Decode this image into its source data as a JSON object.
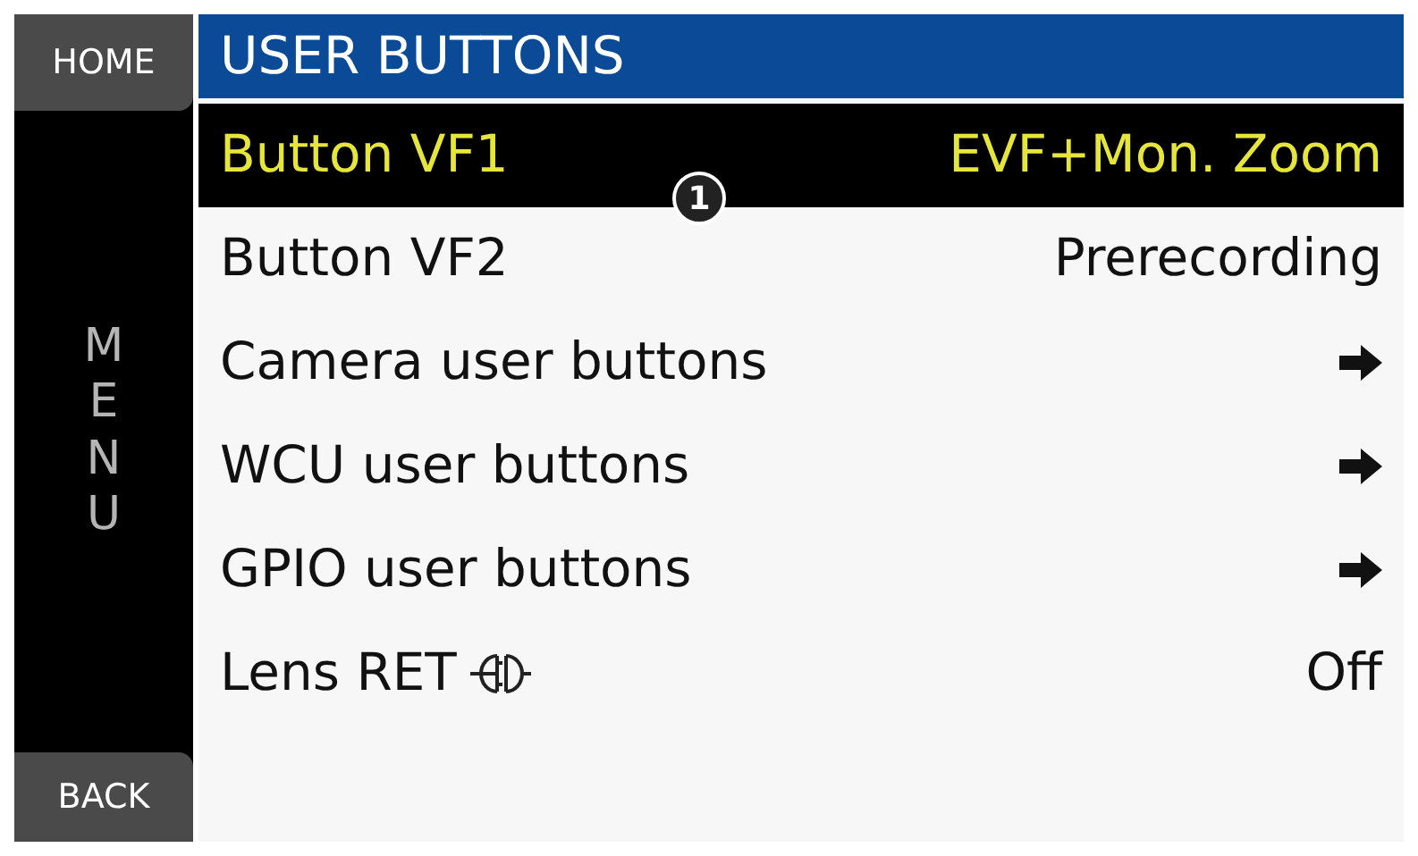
{
  "sidebar": {
    "home": "HOME",
    "vertical_label": "MENU",
    "back": "BACK"
  },
  "header": {
    "title": "USER BUTTONS"
  },
  "rows": [
    {
      "kind": "value",
      "label": "Button VF1",
      "value": "EVF+Mon. Zoom",
      "selected": true
    },
    {
      "kind": "value",
      "label": "Button VF2",
      "value": "Prerecording",
      "selected": false
    },
    {
      "kind": "submenu",
      "label": "Camera user buttons",
      "selected": false
    },
    {
      "kind": "submenu",
      "label": "WCU user buttons",
      "selected": false
    },
    {
      "kind": "submenu",
      "label": "GPIO user buttons",
      "selected": false
    },
    {
      "kind": "value",
      "label": "Lens RET",
      "connector_icon": true,
      "value": "Off",
      "selected": false
    }
  ],
  "callout": {
    "number": "1"
  }
}
